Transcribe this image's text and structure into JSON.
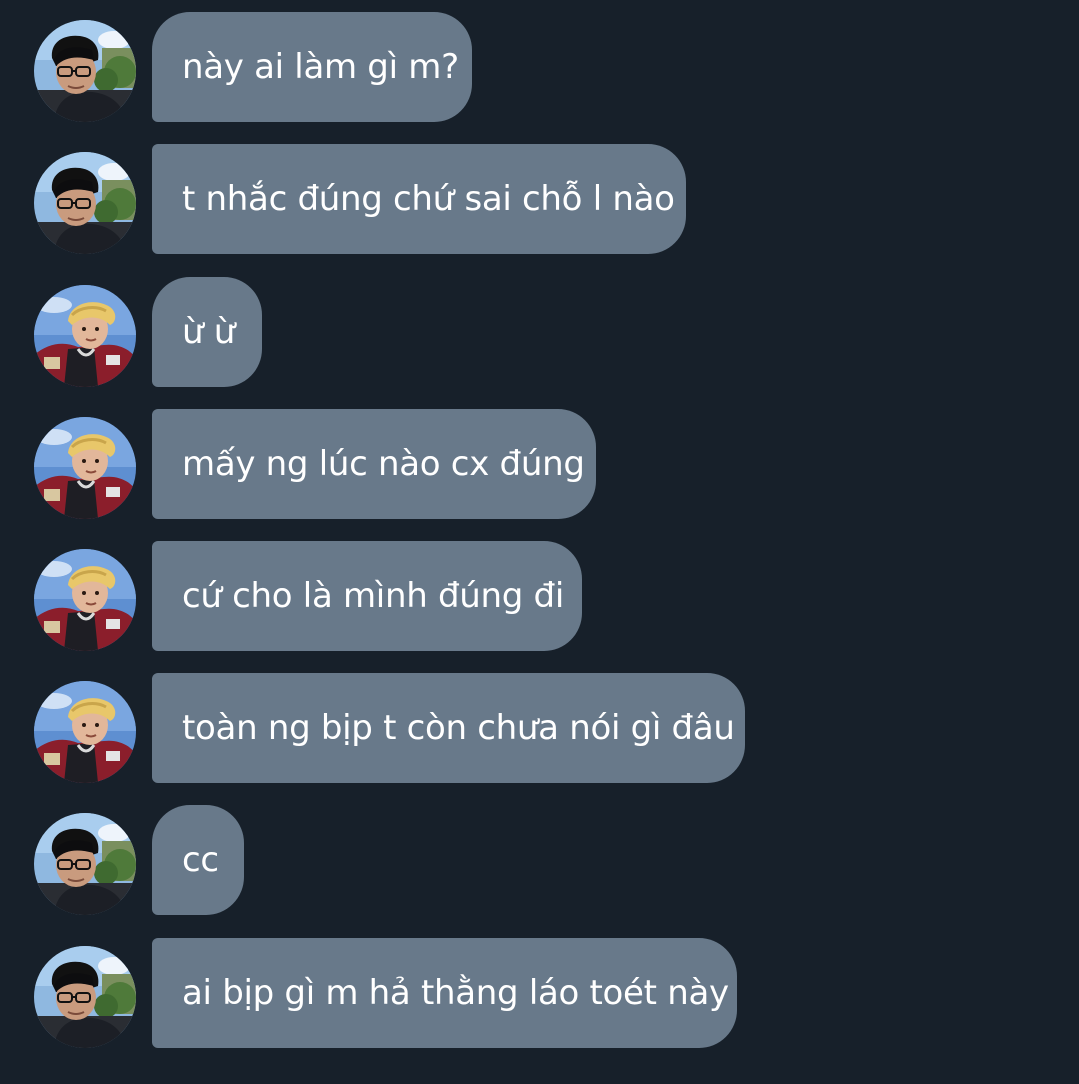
{
  "conversation": {
    "messages": [
      {
        "text": "này ai làm gì m?",
        "avatar": "user-a-avatar"
      },
      {
        "text": "t nhắc đúng chứ sai chỗ l nào",
        "avatar": "user-a-avatar"
      },
      {
        "text": "ừ ừ",
        "avatar": "user-b-avatar"
      },
      {
        "text": "mấy ng lúc nào cx đúng",
        "avatar": "user-b-avatar"
      },
      {
        "text": "cứ cho là mình đúng đi",
        "avatar": "user-b-avatar"
      },
      {
        "text": "toàn ng bịp t còn chưa nói gì đâu",
        "avatar": "user-b-avatar"
      },
      {
        "text": "cc",
        "avatar": "user-a-avatar"
      },
      {
        "text": "ai bịp gì m hả thằng láo toét này",
        "avatar": "user-a-avatar"
      }
    ]
  },
  "colors": {
    "background": "#17202a",
    "bubble": "#68798a",
    "text": "#ffffff"
  }
}
